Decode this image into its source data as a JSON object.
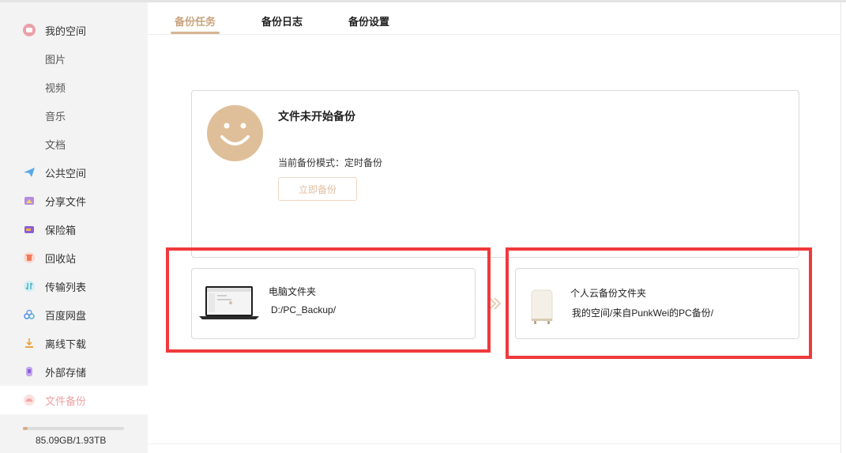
{
  "sidebar": {
    "items": [
      {
        "label": "我的空间",
        "icon": "my-space-icon",
        "color": "#e86a6a"
      },
      {
        "label": "图片"
      },
      {
        "label": "视频"
      },
      {
        "label": "音乐"
      },
      {
        "label": "文档"
      },
      {
        "label": "公共空间",
        "icon": "paper-plane-icon",
        "color": "#5aa7e8"
      },
      {
        "label": "分享文件",
        "icon": "share-icon",
        "color": "#a077d8"
      },
      {
        "label": "保险箱",
        "icon": "safe-icon",
        "color": "#8b5fd6"
      },
      {
        "label": "回收站",
        "icon": "trash-icon",
        "color": "#f07a5a"
      },
      {
        "label": "传输列表",
        "icon": "transfer-icon",
        "color": "#4db3c7"
      },
      {
        "label": "百度网盘",
        "icon": "cloud-icon",
        "color": "#4d8ef0"
      },
      {
        "label": "离线下载",
        "icon": "download-icon",
        "color": "#f0a23c"
      },
      {
        "label": "外部存储",
        "icon": "usb-icon",
        "color": "#9a6bd6"
      },
      {
        "label": "文件备份",
        "icon": "backup-icon",
        "color": "#f08f8f"
      }
    ],
    "storage_text": "85.09GB/1.93TB",
    "storage_fraction": 0.043
  },
  "tabs": [
    {
      "label": "备份任务"
    },
    {
      "label": "备份日志"
    },
    {
      "label": "备份设置"
    }
  ],
  "status": {
    "title": "文件未开始备份",
    "mode_line": "当前备份模式：定时备份",
    "button_label": "立即备份"
  },
  "source": {
    "title": "电脑文件夹",
    "path": "D:/PC_Backup/"
  },
  "target": {
    "title": "个人云备份文件夹",
    "path": "我的空间/来自PunkWei的PC备份/"
  },
  "colors": {
    "accent": "#c8a27c",
    "smiley": "#dfbf99",
    "highlight": "#f0393b"
  }
}
